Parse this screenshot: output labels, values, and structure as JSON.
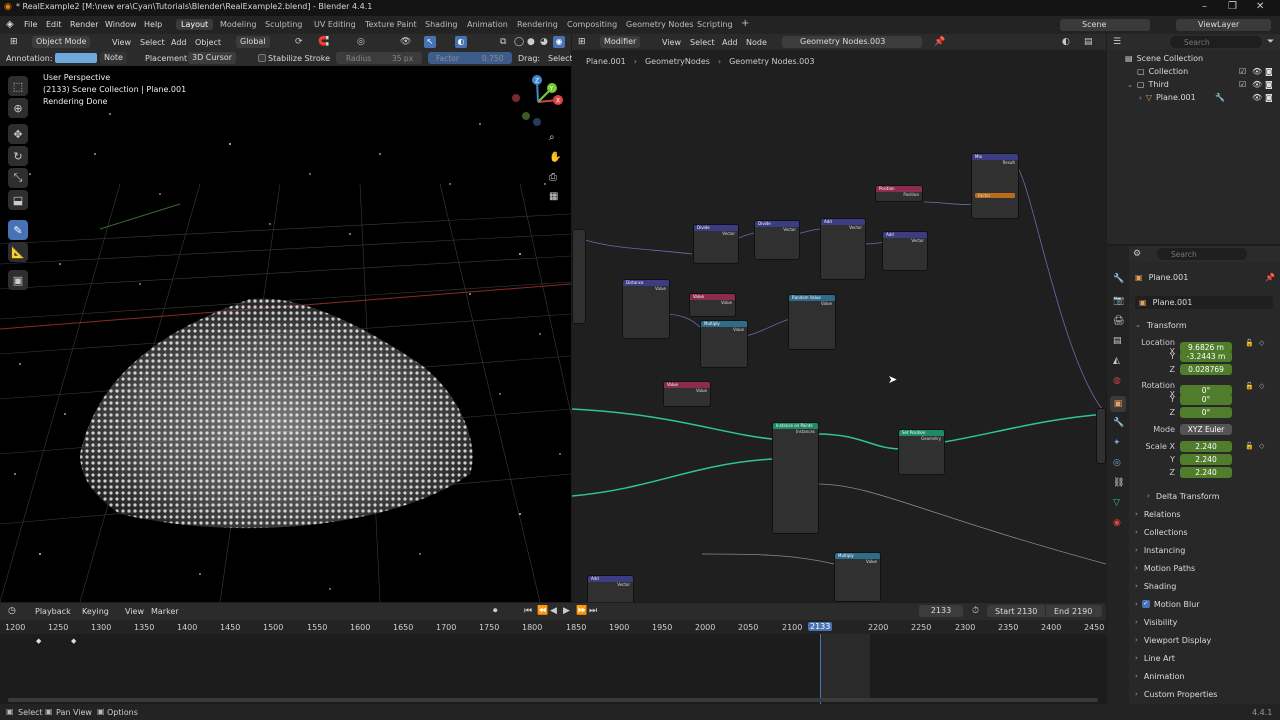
{
  "window": {
    "title": "* RealExample2 [M:\\new era\\Cyan\\Tutorials\\Blender\\RealExample2.blend] - Blender 4.4.1",
    "controls": [
      "–",
      "❐",
      "✕"
    ]
  },
  "menu": {
    "items": [
      "File",
      "Edit",
      "Render",
      "Window",
      "Help"
    ],
    "workspaces": [
      "Layout",
      "Modeling",
      "Sculpting",
      "UV Editing",
      "Texture Paint",
      "Shading",
      "Animation",
      "Rendering",
      "Compositing",
      "Geometry Nodes",
      "Scripting"
    ],
    "active_workspace": "Layout",
    "add_tab": "+",
    "scene": "Scene",
    "view_layer": "ViewLayer"
  },
  "viewport": {
    "mode": "Object Mode",
    "menus": [
      "View",
      "Select",
      "Add",
      "Object"
    ],
    "orientation": "Global",
    "annotation": {
      "label": "Annotation:",
      "placement_label": "Placement:",
      "placement": "3D Cursor",
      "note": "Note",
      "stabilize": "Stabilize Stroke",
      "radius_label": "Radius",
      "radius": "35 px",
      "factor_label": "Factor",
      "factor": "0.750",
      "drag_label": "Drag:",
      "drag": "Select"
    },
    "overlay": {
      "view_name": "User Perspective",
      "collection": "(2133) Scene Collection | Plane.001",
      "status": "Rendering Done"
    },
    "gizmo": {
      "x": "X",
      "y": "Y",
      "z": "Z"
    }
  },
  "node_editor": {
    "editor": "Modifier",
    "menus": [
      "View",
      "Select",
      "Add",
      "Node"
    ],
    "node_tree": "Geometry Nodes.003",
    "breadcrumb": [
      "Plane.001",
      "GeometryNodes",
      "Geometry Nodes.003"
    ],
    "nodes": {
      "divide1": "Divide",
      "divide2": "Divide",
      "add1": "Add",
      "add2": "Add",
      "position": "Position",
      "mix": "Mix",
      "distance": "Distance",
      "value1": "Value",
      "value2": "Value",
      "multiply": "Multiply",
      "random_value": "Random Value",
      "instance_on_points": "Instance on Points",
      "set_position": "Set Position",
      "multiply2": "Multiply",
      "add3": "Add"
    }
  },
  "outliner": {
    "search_placeholder": "Search",
    "root": "Scene Collection",
    "items": [
      "Collection",
      "Third",
      "Plane.001"
    ]
  },
  "properties": {
    "search_placeholder": "Search",
    "object_name": "Plane.001",
    "data_name": "Plane.001",
    "transform": {
      "header": "Transform",
      "location_label": "Location X",
      "location": [
        "9.6826 m",
        "-3.2443 m",
        "0.028769"
      ],
      "rotation_label": "Rotation X",
      "rotation": [
        "0°",
        "0°",
        "0°"
      ],
      "mode_label": "Mode",
      "mode": "XYZ Euler",
      "scale_label": "Scale X",
      "scale": [
        "2.240",
        "2.240",
        "2.240"
      ],
      "axis_y": "Y",
      "axis_z": "Z",
      "delta": "Delta Transform"
    },
    "panels": [
      "Relations",
      "Collections",
      "Instancing",
      "Motion Paths",
      "Shading",
      "Motion Blur",
      "Visibility",
      "Viewport Display",
      "Line Art",
      "Animation",
      "Custom Properties"
    ]
  },
  "timeline": {
    "menus": [
      "Playback",
      "Keying",
      "View",
      "Marker"
    ],
    "current_frame": "2133",
    "start_label": "Start",
    "start": "2130",
    "end_label": "End",
    "end": "2190",
    "ticks": [
      "1200",
      "1250",
      "1300",
      "1350",
      "1400",
      "1450",
      "1500",
      "1550",
      "1600",
      "1650",
      "1700",
      "1750",
      "1800",
      "1850",
      "1900",
      "1950",
      "2000",
      "2050",
      "2100",
      "2133",
      "2200",
      "2250",
      "2300",
      "2350",
      "2400",
      "2450"
    ]
  },
  "statusbar": {
    "items": [
      "Select",
      "Pan View",
      "Options"
    ],
    "version": "4.4.1"
  }
}
